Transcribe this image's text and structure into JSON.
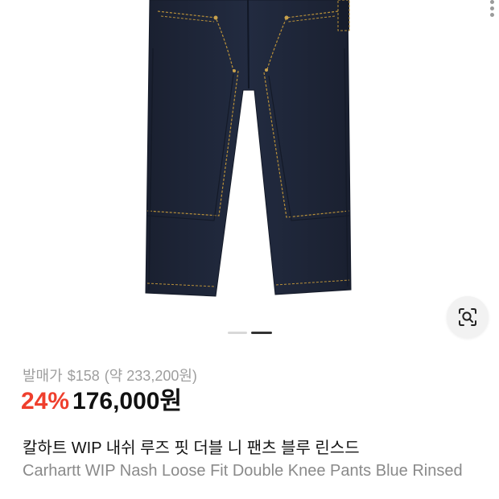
{
  "product": {
    "image_alt": "Carhartt WIP Nash Loose Fit Double Knee Pants - dark rinsed denim",
    "gallery": {
      "current_index": 2,
      "total": 2
    },
    "retail_label": "발매가",
    "retail_price": "$158",
    "retail_krw": "(약 233,200원)",
    "discount": "24%",
    "price": "176,000원",
    "title_ko": "칼하트 WIP 내쉬 루즈 핏 더블 니 팬츠 블루 린스드",
    "title_en": "Carhartt WIP Nash Loose Fit Double Knee Pants Blue Rinsed"
  },
  "icons": {
    "lens": "visual-search-icon",
    "menu": "more-vertical-icon"
  },
  "colors": {
    "discount": "#ef3f2d",
    "denim": "#1c2436",
    "stitch": "#b8903a"
  }
}
